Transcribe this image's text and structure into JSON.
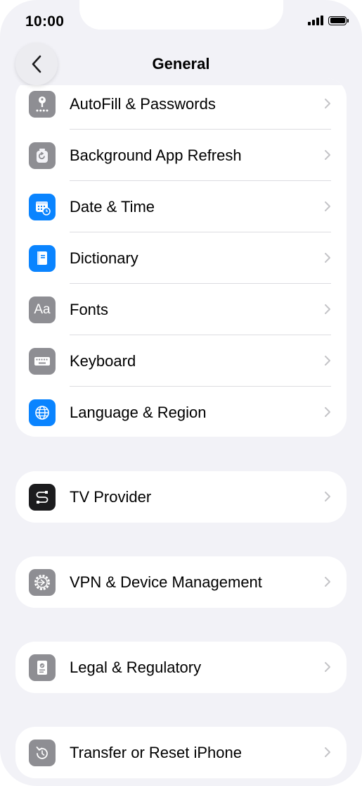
{
  "status_bar": {
    "time": "10:00"
  },
  "nav": {
    "title": "General",
    "back_icon": "chevron-left-icon"
  },
  "groups": [
    {
      "rows": [
        {
          "label": "AutoFill & Passwords",
          "icon": "key-icon",
          "color": "#8e8e93"
        },
        {
          "label": "Background App Refresh",
          "icon": "refresh-icon",
          "color": "#8e8e93"
        },
        {
          "label": "Date & Time",
          "icon": "calendar-clock-icon",
          "color": "#0a84ff"
        },
        {
          "label": "Dictionary",
          "icon": "book-icon",
          "color": "#0a84ff"
        },
        {
          "label": "Fonts",
          "icon": "fonts-icon",
          "icon_text": "Aa",
          "color": "#8e8e93"
        },
        {
          "label": "Keyboard",
          "icon": "keyboard-icon",
          "color": "#8e8e93"
        },
        {
          "label": "Language & Region",
          "icon": "globe-icon",
          "color": "#0a84ff"
        }
      ]
    },
    {
      "rows": [
        {
          "label": "TV Provider",
          "icon": "tv-provider-icon",
          "color": "#1c1c1e"
        }
      ]
    },
    {
      "rows": [
        {
          "label": "VPN & Device Management",
          "icon": "gear-icon",
          "color": "#8e8e93"
        }
      ]
    },
    {
      "rows": [
        {
          "label": "Legal & Regulatory",
          "icon": "document-badge-icon",
          "color": "#8e8e93"
        }
      ]
    },
    {
      "rows": [
        {
          "label": "Transfer or Reset iPhone",
          "icon": "reset-icon",
          "color": "#8e8e93"
        }
      ]
    }
  ]
}
